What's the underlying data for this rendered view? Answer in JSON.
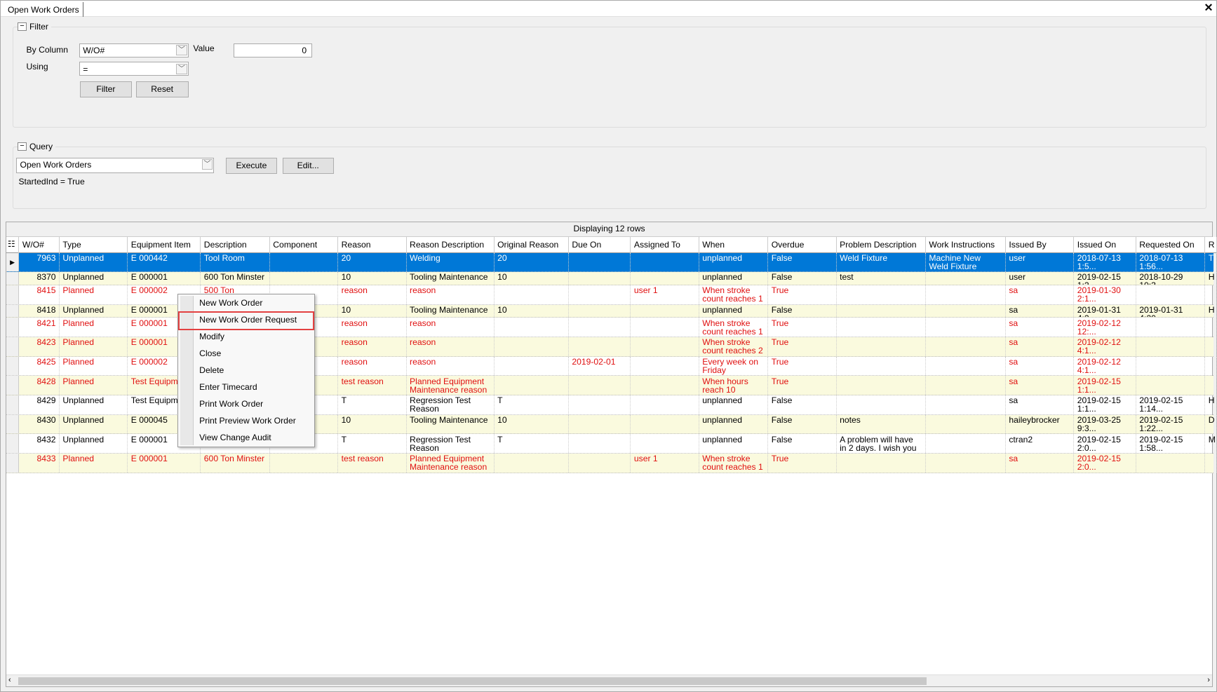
{
  "window": {
    "tab_title": "Open Work Orders",
    "close_icon": "close-icon"
  },
  "filter": {
    "title": "Filter",
    "by_column_label": "By Column",
    "by_column_value": "W/O#",
    "using_label": "Using",
    "using_value": "=",
    "value_label": "Value",
    "value": "0",
    "filter_button": "Filter",
    "reset_button": "Reset"
  },
  "query": {
    "title": "Query",
    "selected": "Open Work Orders",
    "execute_button": "Execute",
    "edit_button": "Edit...",
    "condition": "StartedInd = True"
  },
  "grid": {
    "caption": "Displaying 12 rows",
    "columns": [
      "W/O#",
      "Type",
      "Equipment Item",
      "Description",
      "Component",
      "Reason",
      "Reason Description",
      "Original Reason",
      "Due On",
      "Assigned To",
      "When",
      "Overdue",
      "Problem Description",
      "Work Instructions",
      "Issued By",
      "Issued On",
      "Requested On",
      "R"
    ],
    "rows": [
      [
        "7963",
        "Unplanned",
        "E 000442",
        "Tool Room",
        "",
        "20",
        "Welding",
        "20",
        "",
        "",
        "unplanned",
        "False",
        "Weld Fixture",
        "Machine New Weld Fixture",
        "user",
        "2018-07-13 1:5...",
        "2018-07-13 1:56...",
        "T"
      ],
      [
        "8370",
        "Unplanned",
        "E 000001",
        "600 Ton Minster",
        "",
        "10",
        "Tooling Maintenance",
        "10",
        "",
        "",
        "unplanned",
        "False",
        "test",
        "",
        "user",
        "2019-02-15 1:2...",
        "2018-10-29 10:3...",
        "H"
      ],
      [
        "8415",
        "Planned",
        "E 000002",
        "500 Ton Niagara",
        "",
        "reason",
        "reason",
        "",
        "",
        "user 1",
        "When stroke count reaches 1",
        "True",
        "",
        "",
        "sa",
        "2019-01-30 2:1...",
        "",
        ""
      ],
      [
        "8418",
        "Unplanned",
        "E 000001",
        "",
        "",
        "10",
        "Tooling Maintenance",
        "10",
        "",
        "",
        "unplanned",
        "False",
        "",
        "",
        "sa",
        "2019-01-31 4:2...",
        "2019-01-31 4:20...",
        "H"
      ],
      [
        "8421",
        "Planned",
        "E 000001",
        "",
        "",
        "reason",
        "reason",
        "",
        "",
        "",
        "When stroke count reaches 1",
        "True",
        "",
        "",
        "sa",
        "2019-02-12 12:...",
        "",
        ""
      ],
      [
        "8423",
        "Planned",
        "E 000001",
        "",
        "",
        "reason",
        "reason",
        "",
        "",
        "",
        "When stroke count reaches 2",
        "True",
        "",
        "",
        "sa",
        "2019-02-12 4:1...",
        "",
        ""
      ],
      [
        "8425",
        "Planned",
        "E 000002",
        "",
        "",
        "reason",
        "reason",
        "",
        "2019-02-01",
        "",
        "Every week on Friday",
        "True",
        "",
        "",
        "sa",
        "2019-02-12 4:1...",
        "",
        ""
      ],
      [
        "8428",
        "Planned",
        "Test Equipme",
        "",
        "",
        "test reason",
        "Planned Equipment Maintenance reason",
        "",
        "",
        "",
        "When hours reach 10",
        "True",
        "",
        "",
        "sa",
        "2019-02-15 1:1...",
        "",
        ""
      ],
      [
        "8429",
        "Unplanned",
        "Test Equipme",
        "",
        "",
        "T",
        "Regression Test Reason",
        "T",
        "",
        "",
        "unplanned",
        "False",
        "",
        "",
        "sa",
        "2019-02-15 1:1...",
        "2019-02-15 1:14...",
        "H"
      ],
      [
        "8430",
        "Unplanned",
        "E 000045",
        "",
        "",
        "10",
        "Tooling Maintenance",
        "10",
        "",
        "",
        "unplanned",
        "False",
        "notes",
        "",
        "haileybrocker",
        "2019-03-25 9:3...",
        "2019-02-15 1:22...",
        "D"
      ],
      [
        "8432",
        "Unplanned",
        "E 000001",
        "",
        "",
        "T",
        "Regression Test Reason",
        "T",
        "",
        "",
        "unplanned",
        "False",
        "A problem will have in 2 days. I wish you luck.",
        "",
        "ctran2",
        "2019-02-15 2:0...",
        "2019-02-15 1:58...",
        "M"
      ],
      [
        "8433",
        "Planned",
        "E 000001",
        "600 Ton Minster",
        "",
        "test reason",
        "Planned Equipment Maintenance reason",
        "",
        "",
        "user 1",
        "When stroke count reaches 1",
        "True",
        "",
        "",
        "sa",
        "2019-02-15 2:0...",
        "",
        ""
      ]
    ],
    "selected_row": 0
  },
  "context_menu": {
    "items": [
      "New Work Order",
      "New Work Order Request",
      "Modify",
      "Close",
      "Delete",
      "Enter Timecard",
      "Print Work Order",
      "Print Preview Work Order",
      "View Change Audit"
    ],
    "highlighted": "New Work Order Request"
  },
  "colors": {
    "selection": "#0078d7",
    "alt_row": "#fafade",
    "overdue_text": "#e01010",
    "highlight_box": "#e34040"
  }
}
